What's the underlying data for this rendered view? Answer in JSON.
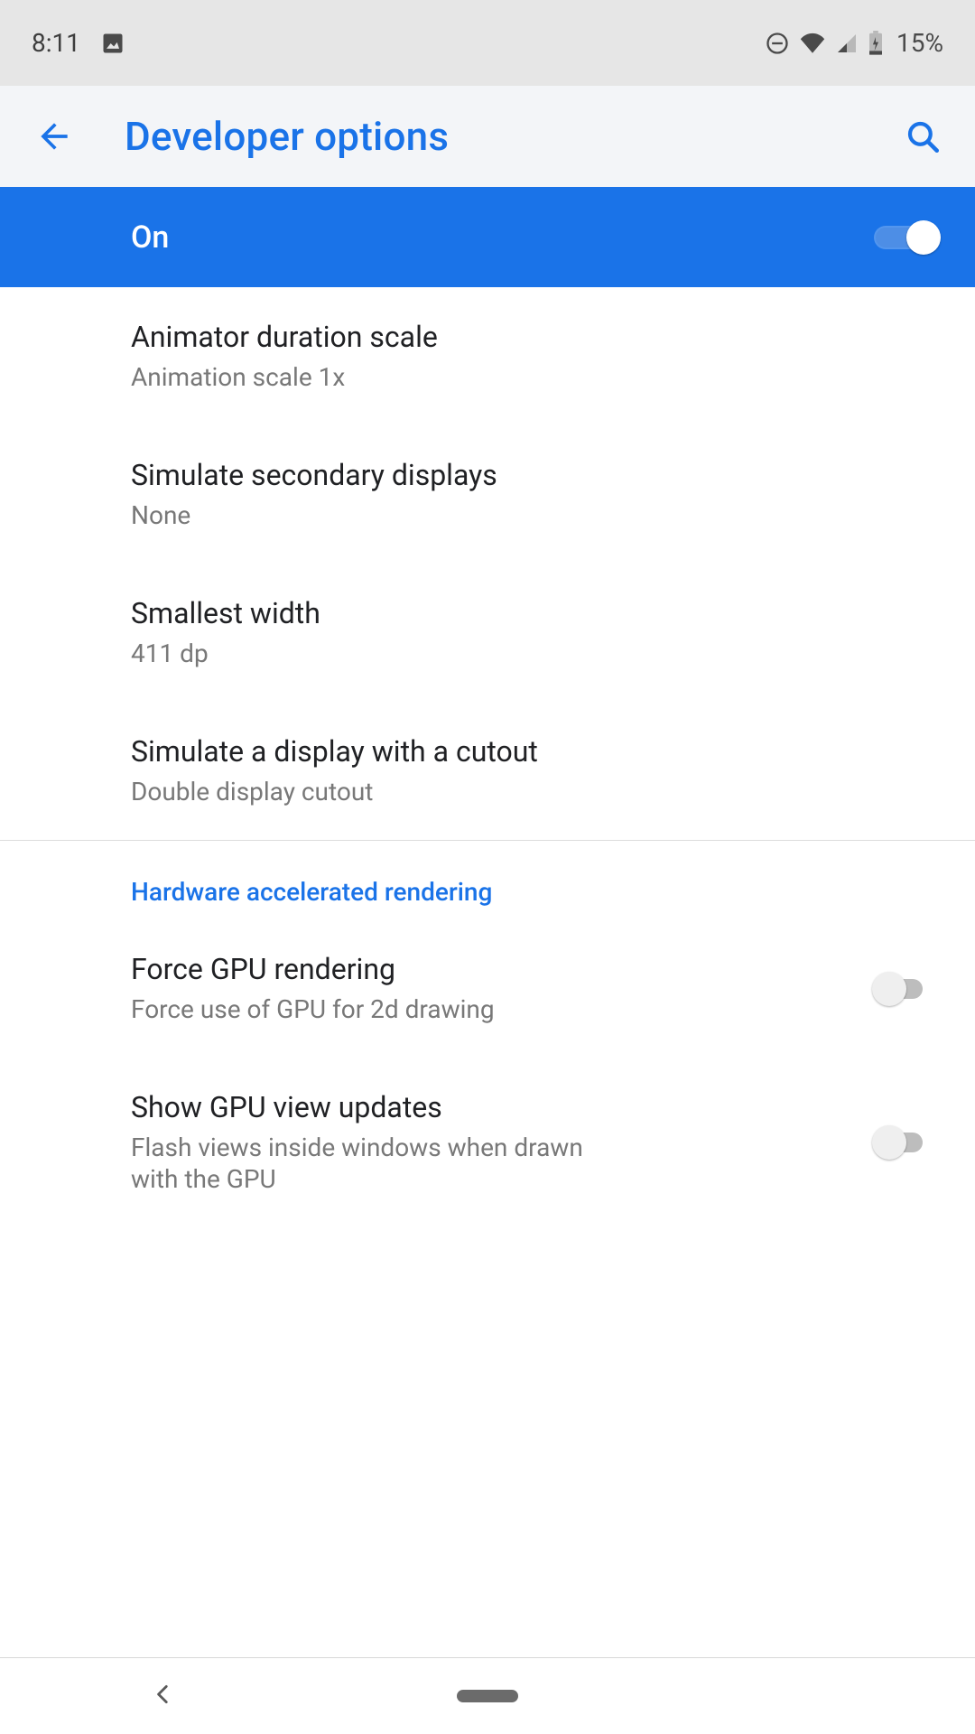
{
  "status": {
    "time": "8:11",
    "battery_pct": "15%"
  },
  "appbar": {
    "title": "Developer options"
  },
  "master": {
    "label": "On",
    "enabled": true
  },
  "items": [
    {
      "title": "Animator duration scale",
      "sub": "Animation scale 1x"
    },
    {
      "title": "Simulate secondary displays",
      "sub": "None"
    },
    {
      "title": "Smallest width",
      "sub": "411 dp"
    },
    {
      "title": "Simulate a display with a cutout",
      "sub": "Double display cutout"
    }
  ],
  "section_header": "Hardware accelerated rendering",
  "toggle_items": [
    {
      "title": "Force GPU rendering",
      "sub": "Force use of GPU for 2d drawing",
      "on": false
    },
    {
      "title": "Show GPU view updates",
      "sub": "Flash views inside windows when drawn with the GPU",
      "on": false
    }
  ]
}
